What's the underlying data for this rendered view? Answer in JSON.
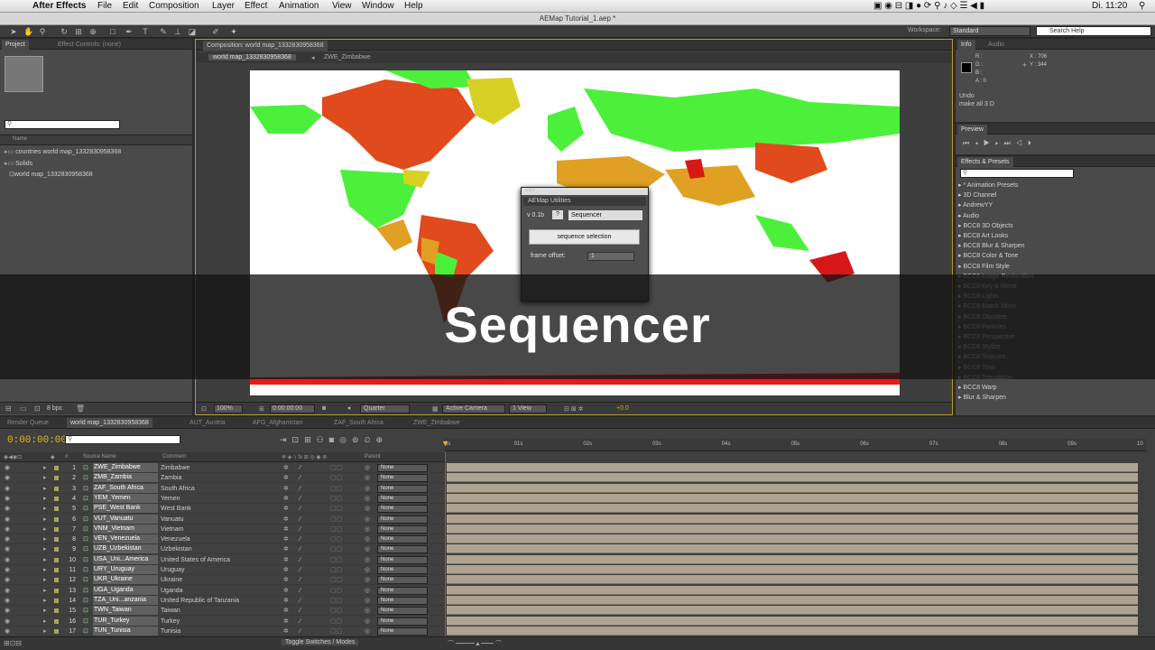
{
  "menubar": {
    "apple": "",
    "app_name": "After Effects",
    "items": [
      "File",
      "Edit",
      "Composition",
      "Layer",
      "Effect",
      "Animation",
      "View",
      "Window",
      "Help"
    ],
    "clock": "Di. 11:20"
  },
  "window_title": "AEMap Tutorial_1.aep *",
  "toolbar": {
    "workspace_label": "Workspace:",
    "workspace_value": "Standard",
    "search_help": "Search Help"
  },
  "project_panel": {
    "tabs": [
      "Project",
      "Effect Controls: (none)"
    ],
    "column_name": "Name",
    "items": [
      {
        "icon": "folder-icon",
        "label": "countries world map_1332830958368"
      },
      {
        "icon": "folder-icon",
        "label": "Solids"
      },
      {
        "icon": "composition-icon",
        "label": "world map_1332830958368"
      }
    ],
    "bpc": "8 bpc"
  },
  "composition_panel": {
    "tab": "Composition: world map_1332830958368",
    "breadcrumbs": [
      "world map_1332830958368",
      "ZWE_Zimbabwe"
    ],
    "zoom": "100%",
    "timecode": "0:00:00:00",
    "resolution": "Quarter",
    "camera": "Active Camera",
    "view": "1 View",
    "exposure": "+0.0"
  },
  "aemap_dialog": {
    "title": "AEMap Utilities",
    "version": "v 0.1b",
    "help": "?",
    "mode": "Sequencer",
    "button": "sequence selection",
    "offset_label": "frame offset:",
    "offset_value": "1"
  },
  "info_panel": {
    "tabs": [
      "Info",
      "Audio"
    ],
    "r": "R :",
    "g": "G :",
    "b": "B :",
    "a": "A : 0",
    "x": "X : 706",
    "y": "Y : 344",
    "undo_label": "Undo",
    "undo_value": "make all 3 D"
  },
  "preview_panel": {
    "tab": "Preview"
  },
  "effects_panel": {
    "tab": "Effects & Presets",
    "items": [
      "* Animation Presets",
      "3D Channel",
      "AndrewYY",
      "Audio",
      "BCC8 3D Objects",
      "BCC8 Art Looks",
      "BCC8 Blur & Sharpen",
      "BCC8 Color & Tone",
      "BCC8 Film Style",
      "BCC8 Image Restoration",
      "BCC8 Key & Blend",
      "BCC8 Lights",
      "BCC8 Match Move",
      "BCC8 Obsolete",
      "BCC8 Particles",
      "BCC8 Perspective",
      "BCC8 Stylize",
      "BCC8 Textures",
      "BCC8 Time",
      "BCC8 Transitions",
      "BCC8 Warp",
      "Blur & Sharpen"
    ]
  },
  "timeline": {
    "tabs": [
      "Render Queue",
      "world map_1332830958368",
      "AUT_Austria",
      "AFG_Afghanistan",
      "ZAF_South Africa",
      "ZWE_Zimbabwe"
    ],
    "timecode": "0:00:00:00",
    "col_source": "Source Name",
    "col_comment": "Comment",
    "col_parent": "Parent",
    "ruler": [
      "0s",
      "01s",
      "02s",
      "03s",
      "04s",
      "05s",
      "06s",
      "07s",
      "08s",
      "09s",
      "10"
    ],
    "footer": "Toggle Switches / Modes",
    "layers": [
      {
        "n": "1",
        "source": "ZWE_Zimbabwe",
        "comment": "Zimbabwe",
        "parent": "None"
      },
      {
        "n": "2",
        "source": "ZMB_Zambia",
        "comment": "Zambia",
        "parent": "None"
      },
      {
        "n": "3",
        "source": "ZAF_South Africa",
        "comment": "South Africa",
        "parent": "None"
      },
      {
        "n": "4",
        "source": "YEM_Yemen",
        "comment": "Yemen",
        "parent": "None"
      },
      {
        "n": "5",
        "source": "PSE_West Bank",
        "comment": "West Bank",
        "parent": "None"
      },
      {
        "n": "6",
        "source": "VUT_Vanuatu",
        "comment": "Vanuatu",
        "parent": "None"
      },
      {
        "n": "7",
        "source": "VNM_Vietnam",
        "comment": "Vietnam",
        "parent": "None"
      },
      {
        "n": "8",
        "source": "VEN_Venezuela",
        "comment": "Venezuela",
        "parent": "None"
      },
      {
        "n": "9",
        "source": "UZB_Uzbekistan",
        "comment": "Uzbekistan",
        "parent": "None"
      },
      {
        "n": "10",
        "source": "USA_Uni...America",
        "comment": "United States of America",
        "parent": "None"
      },
      {
        "n": "11",
        "source": "URY_Uruguay",
        "comment": "Uruguay",
        "parent": "None"
      },
      {
        "n": "12",
        "source": "UKR_Ukraine",
        "comment": "Ukraine",
        "parent": "None"
      },
      {
        "n": "13",
        "source": "UGA_Uganda",
        "comment": "Uganda",
        "parent": "None"
      },
      {
        "n": "14",
        "source": "TZA_Uni...anzania",
        "comment": "United Republic of Tanzania",
        "parent": "None"
      },
      {
        "n": "15",
        "source": "TWN_Taiwan",
        "comment": "Taiwan",
        "parent": "None"
      },
      {
        "n": "16",
        "source": "TUR_Turkey",
        "comment": "Turkey",
        "parent": "None"
      },
      {
        "n": "17",
        "source": "TUN_Tunisia",
        "comment": "Tunisia",
        "parent": "None"
      }
    ]
  },
  "caption": "Sequencer",
  "colors": {
    "map_green": "#4cf03a",
    "map_red": "#e04a1c",
    "map_orange": "#e0a024",
    "map_yellow": "#d8d024",
    "label_olive": "#a8a45c",
    "layer_bar": "#aea391",
    "timecode": "#e8b220"
  }
}
